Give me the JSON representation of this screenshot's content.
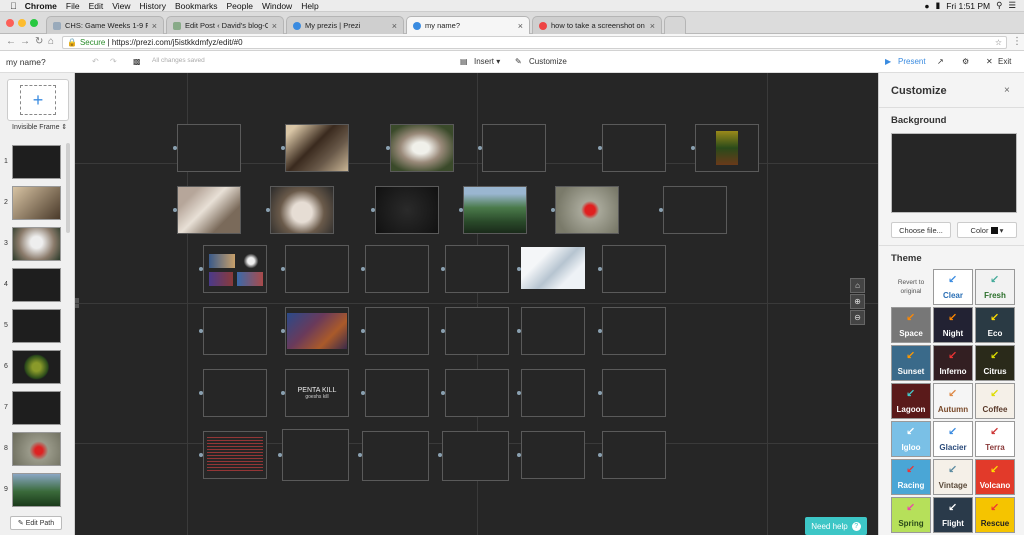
{
  "menubar": {
    "apple": "",
    "app": "Chrome",
    "items": [
      "File",
      "Edit",
      "View",
      "History",
      "Bookmarks",
      "People",
      "Window",
      "Help"
    ],
    "clock": "Fri 1:51 PM"
  },
  "tabs": [
    {
      "label": "CHS: Game Weeks 1-9 Fall",
      "color": "#9ab"
    },
    {
      "label": "Edit Post ‹ David's blog-CHS",
      "color": "#8a8"
    },
    {
      "label": "My prezis | Prezi",
      "color": "#3a8be0"
    },
    {
      "label": "my name?",
      "color": "#3a8be0"
    },
    {
      "label": "how to take a screenshot on a",
      "color": "#e44"
    }
  ],
  "address": {
    "secure": "Secure",
    "url": "https://prezi.com/j5istkkdmfyz/edit/#0"
  },
  "prezi": {
    "title": "my name?",
    "saved": "All changes saved",
    "insert": "Insert",
    "customize": "Customize",
    "present": "Present",
    "exit": "Exit"
  },
  "leftpanel": {
    "frame_type": "Invisible Frame",
    "numbers": [
      "1",
      "2",
      "3",
      "4",
      "5",
      "6",
      "7",
      "8",
      "9"
    ],
    "edit_path": "Edit Path"
  },
  "canvas": {
    "slide_title": "PENTA KILL",
    "slide_sub": "goeshs kill",
    "need_help": "Need help"
  },
  "rightpanel": {
    "title": "Customize",
    "background": "Background",
    "choose_file": "Choose file...",
    "color": "Color",
    "theme": "Theme",
    "revert": "Revert to original",
    "themes": [
      {
        "name": "Clear",
        "bg": "#ffffff",
        "fg": "#2a6fb5",
        "arrow": "#3a8be0"
      },
      {
        "name": "Fresh",
        "bg": "#f2f2f2",
        "fg": "#2a6f2a",
        "arrow": "#4a9"
      },
      {
        "name": "Space",
        "bg": "#777777",
        "fg": "#ffffff",
        "arrow": "#f80"
      },
      {
        "name": "Night",
        "bg": "#222233",
        "fg": "#ffffff",
        "arrow": "#f80"
      },
      {
        "name": "Eco",
        "bg": "#2a3a44",
        "fg": "#ffffff",
        "arrow": "#fd0"
      },
      {
        "name": "Sunset",
        "bg": "#3a6a8a",
        "fg": "#ffffff",
        "arrow": "#f90"
      },
      {
        "name": "Inferno",
        "bg": "#331f22",
        "fg": "#ffffff",
        "arrow": "#e33"
      },
      {
        "name": "Citrus",
        "bg": "#2a2a1a",
        "fg": "#ffffff",
        "arrow": "#dd0"
      },
      {
        "name": "Lagoon",
        "bg": "#5a1a1a",
        "fg": "#ffffff",
        "arrow": "#4cc"
      },
      {
        "name": "Autumn",
        "bg": "#f5f5f5",
        "fg": "#7a4a2a",
        "arrow": "#d84"
      },
      {
        "name": "Coffee",
        "bg": "#f5f0e8",
        "fg": "#5a3a2a",
        "arrow": "#dd0"
      },
      {
        "name": "Igloo",
        "bg": "#7ac0e6",
        "fg": "#ffffff",
        "arrow": "#fff"
      },
      {
        "name": "Glacier",
        "bg": "#ffffff",
        "fg": "#2a4a7a",
        "arrow": "#3a8be0"
      },
      {
        "name": "Terra",
        "bg": "#ffffff",
        "fg": "#8a3a3a",
        "arrow": "#c33"
      },
      {
        "name": "Racing",
        "bg": "#4aa6d6",
        "fg": "#ffffff",
        "arrow": "#e33"
      },
      {
        "name": "Vintage",
        "bg": "#f5f0e8",
        "fg": "#5a4a3a",
        "arrow": "#5a8aa0"
      },
      {
        "name": "Volcano",
        "bg": "#e23a2a",
        "fg": "#ffffff",
        "arrow": "#fd0"
      },
      {
        "name": "Spring",
        "bg": "#b6e05a",
        "fg": "#2a4a1a",
        "arrow": "#e4a"
      },
      {
        "name": "Flight",
        "bg": "#2a3a4a",
        "fg": "#ffffff",
        "arrow": "#fff"
      },
      {
        "name": "Rescue",
        "bg": "#f5c400",
        "fg": "#222222",
        "arrow": "#e33"
      }
    ]
  }
}
